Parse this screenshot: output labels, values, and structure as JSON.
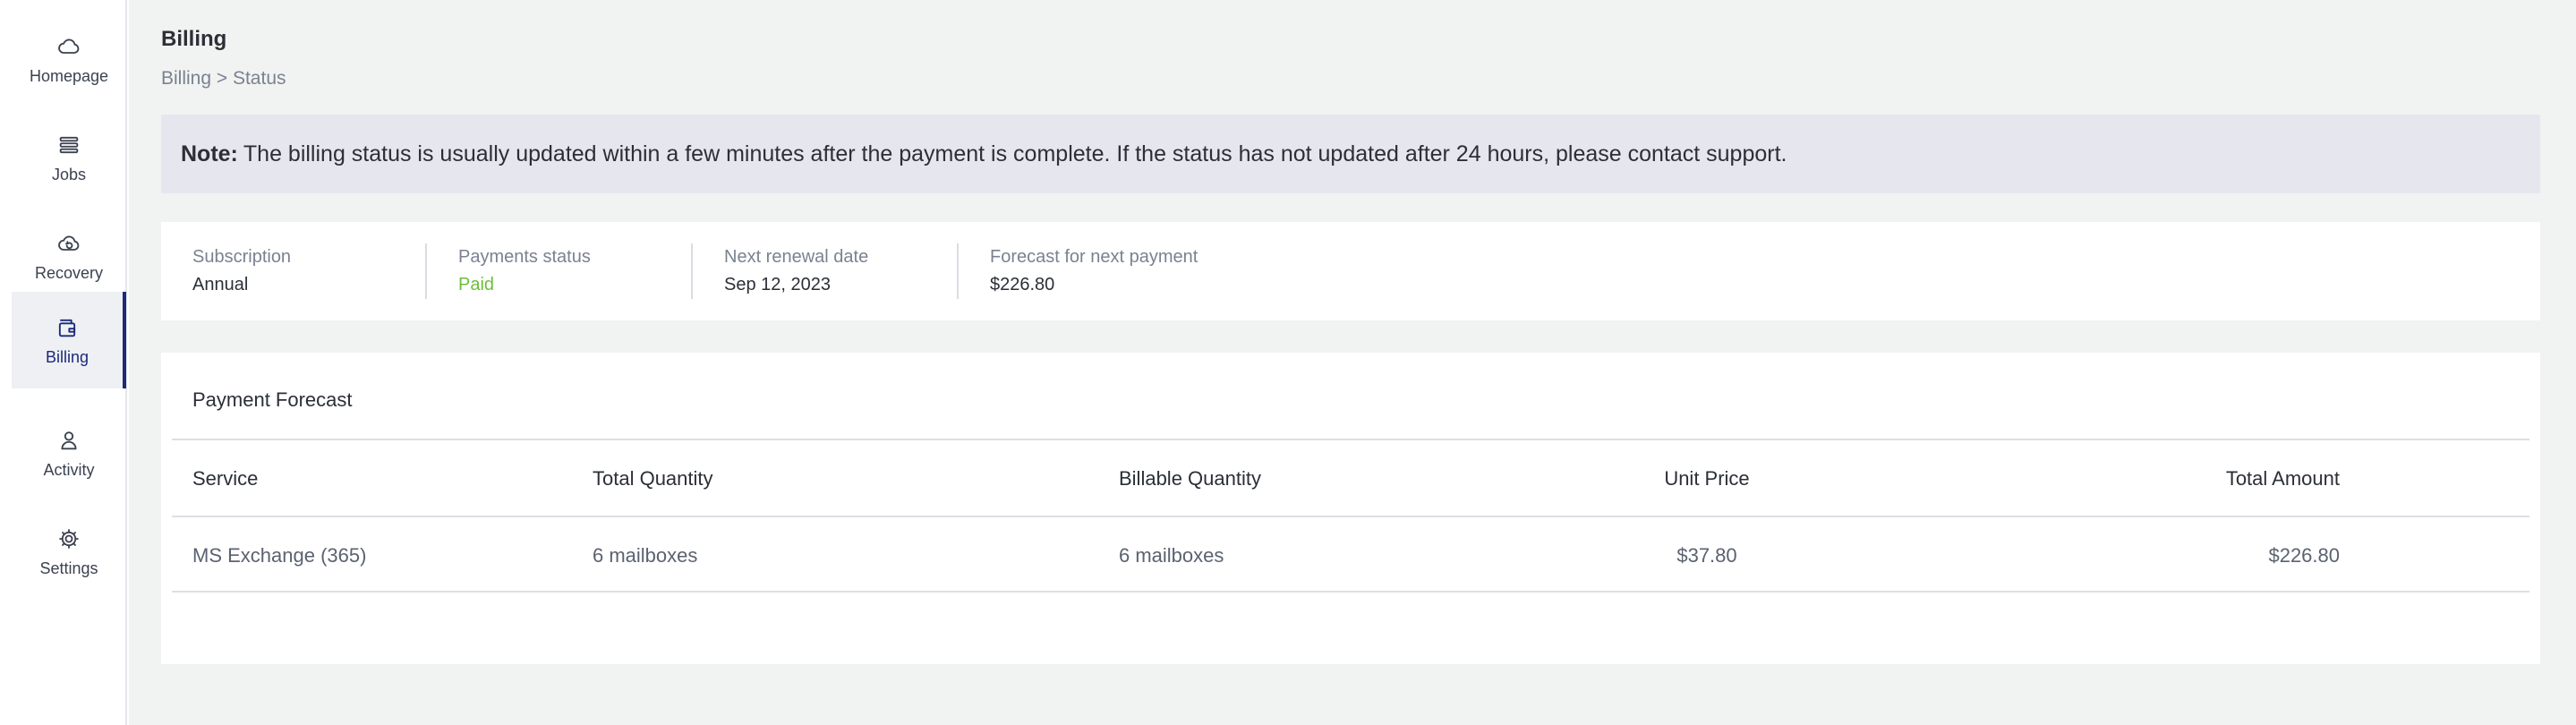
{
  "sidebar": {
    "items": [
      {
        "label": "Homepage",
        "icon": "cloud-icon"
      },
      {
        "label": "Jobs",
        "icon": "stack-icon"
      },
      {
        "label": "Recovery",
        "icon": "cloud-restore-icon"
      },
      {
        "label": "Billing",
        "icon": "wallet-icon",
        "active": true
      },
      {
        "label": "Activity",
        "icon": "user-icon"
      },
      {
        "label": "Settings",
        "icon": "gear-icon"
      }
    ]
  },
  "header": {
    "title": "Billing",
    "breadcrumb": "Billing > Status"
  },
  "note": {
    "prefix": "Note:",
    "text": "The billing status is usually updated within a few minutes after the payment is complete. If the status has not updated after 24 hours, please contact support."
  },
  "summary": [
    {
      "label": "Subscription",
      "value": "Annual"
    },
    {
      "label": "Payments status",
      "value": "Paid"
    },
    {
      "label": "Next renewal date",
      "value": "Sep 12, 2023"
    },
    {
      "label": "Forecast for next payment",
      "value": "$226.80"
    }
  ],
  "forecast": {
    "title": "Payment Forecast",
    "columns": [
      "Service",
      "Total Quantity",
      "Billable Quantity",
      "Unit Price",
      "Total Amount"
    ],
    "rows": [
      [
        "MS Exchange (365)",
        "6 mailboxes",
        "6 mailboxes",
        "$37.80",
        "$226.80"
      ]
    ]
  },
  "colors": {
    "accent": "#1b2a7a",
    "paid": "#6cbf3b",
    "note_bg": "#e6e7ee",
    "page_bg": "#f1f2f2"
  }
}
